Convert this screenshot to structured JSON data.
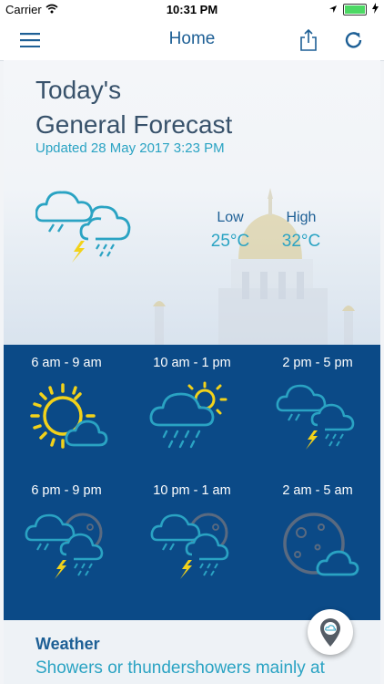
{
  "status": {
    "carrier": "Carrier",
    "time": "10:31 PM"
  },
  "nav": {
    "title": "Home"
  },
  "hero": {
    "title_line1": "Today's",
    "title_line2": "General Forecast",
    "updated": "Updated 28 May 2017 3:23 PM",
    "icon": "cloud-thunder-rain-icon",
    "low_label": "Low",
    "low_value": "25°C",
    "high_label": "High",
    "high_value": "32°C"
  },
  "periods": [
    {
      "time": "6 am - 9 am",
      "icon": "sun-cloud-icon"
    },
    {
      "time": "10 am - 1 pm",
      "icon": "cloud-rain-sun-icon"
    },
    {
      "time": "2 pm - 5 pm",
      "icon": "cloud-thunder-rain-icon"
    },
    {
      "time": "6 pm - 9 pm",
      "icon": "night-thunder-icon"
    },
    {
      "time": "10 pm - 1 am",
      "icon": "night-thunder-icon"
    },
    {
      "time": "2 am - 5 am",
      "icon": "moon-cloud-icon"
    }
  ],
  "weather": {
    "title": "Weather",
    "text": "Showers or thundershowers mainly at"
  },
  "colors": {
    "brand": "#1d5f95",
    "accent": "#2aa3c3",
    "panel": "#0b4a87",
    "sun": "#f2d21a"
  }
}
